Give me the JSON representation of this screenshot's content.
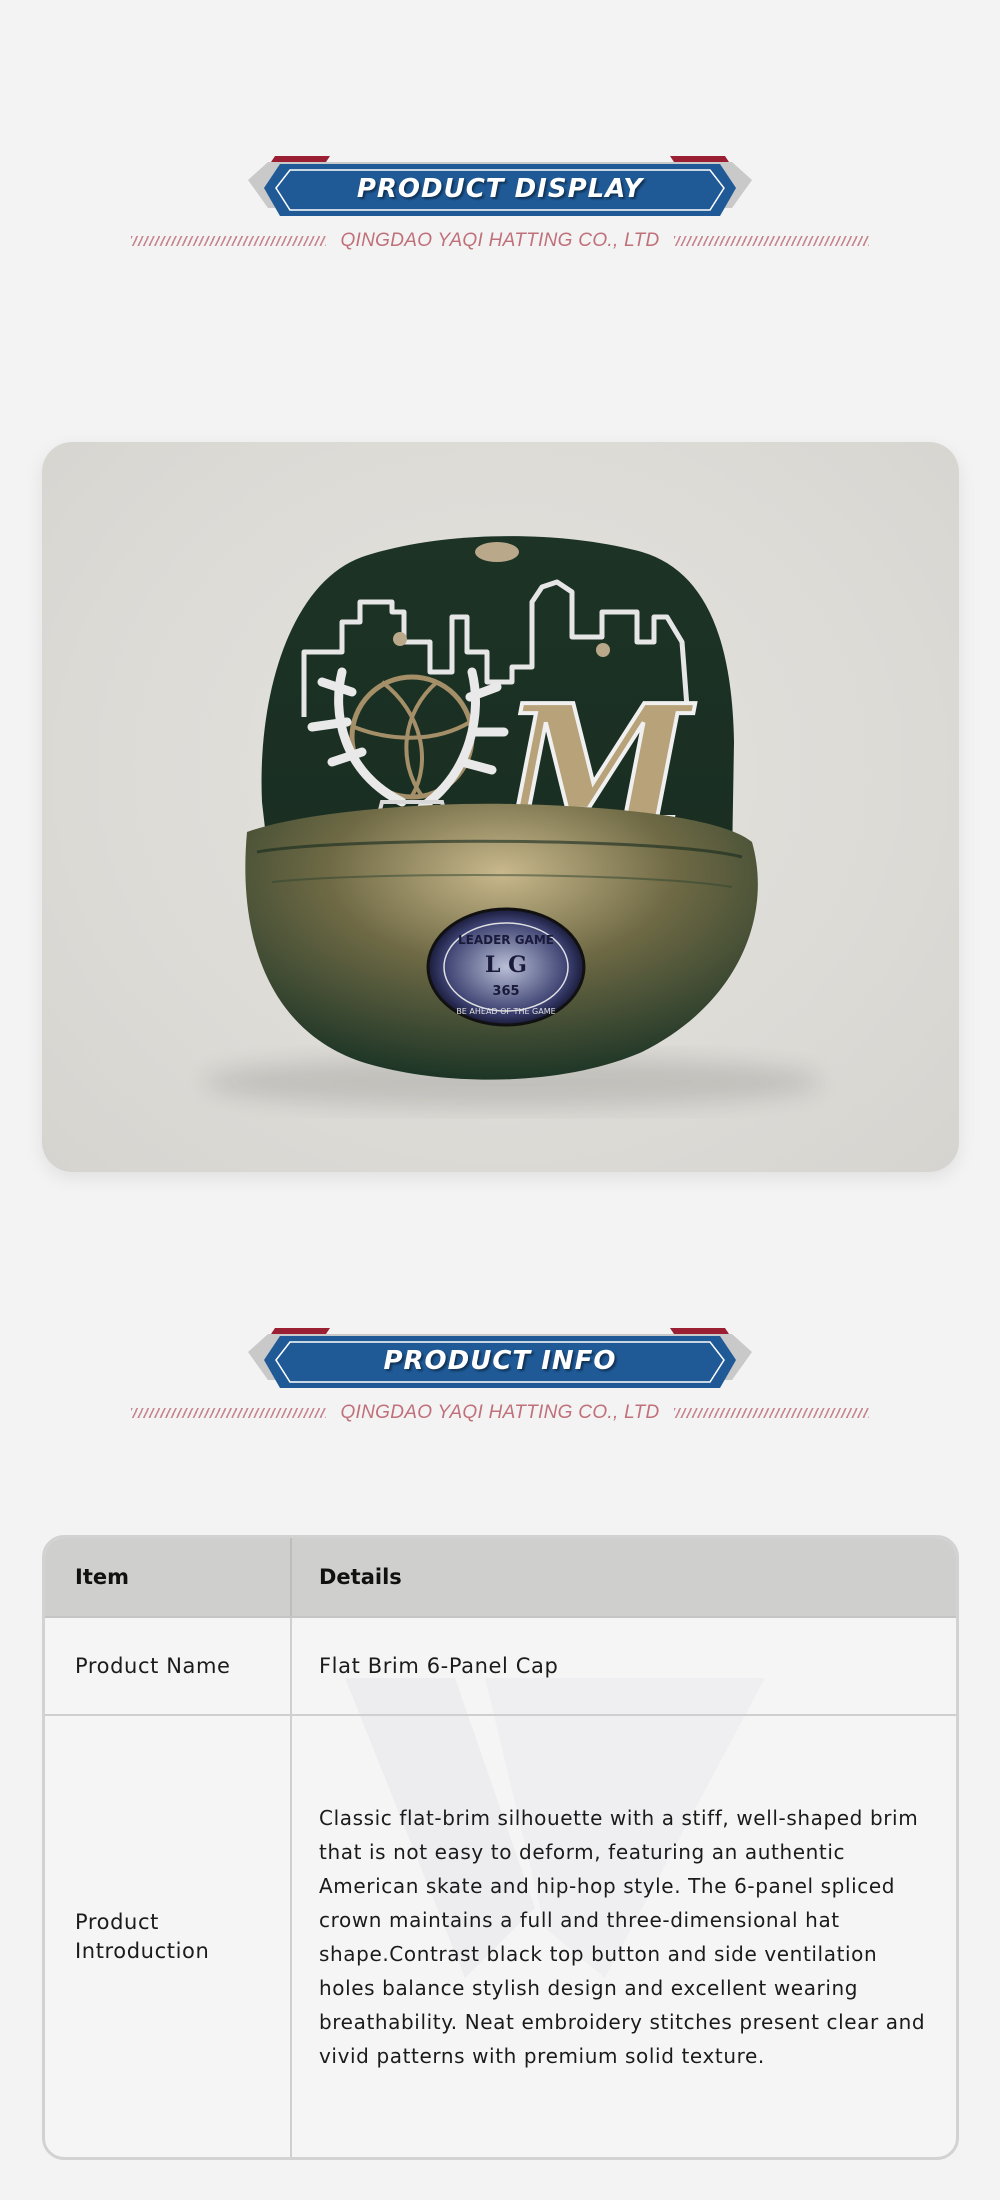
{
  "sections": {
    "display": {
      "title": "PRODUCT DISPLAY",
      "company": "QINGDAO YAQI HATTING CO., LTD"
    },
    "info": {
      "title": "PRODUCT INFO",
      "company": "QINGDAO YAQI HATTING CO., LTD"
    }
  },
  "colors": {
    "banner_blue": "#1f5a97",
    "banner_red": "#9b1f33",
    "banner_grey": "#c9c9c9",
    "company_text": "#c0707a",
    "table_header": "#cfcfcd",
    "cap_green": "#1f3a2a",
    "cap_gold": "#b7a27a"
  },
  "product_image": {
    "subject": "dark green flat brim 6-panel snapback cap with embroidered city skyline, basketball, deer antlers and gold letter M; round patch on brim",
    "patch_text": {
      "top": "LEADER GAME",
      "letters": "L G",
      "number": "365",
      "bottom": "BE AHEAD OF THE GAME"
    },
    "front_letter": "M"
  },
  "table": {
    "headers": [
      "Item",
      "Details"
    ],
    "rows": [
      {
        "item": "Product Name",
        "details": "Flat Brim 6-Panel Cap"
      },
      {
        "item": "Product Introduction",
        "details": "Classic flat-brim silhouette with a stiff, well-shaped brim that is not easy to deform, featuring an authentic American skate and hip-hop style. The 6-panel spliced crown maintains a full and three-dimensional hat shape.Contrast black top button and side ventilation holes balance stylish design and excellent wearing breathability. Neat embroidery stitches present clear and vivid patterns with premium solid texture."
      }
    ]
  }
}
